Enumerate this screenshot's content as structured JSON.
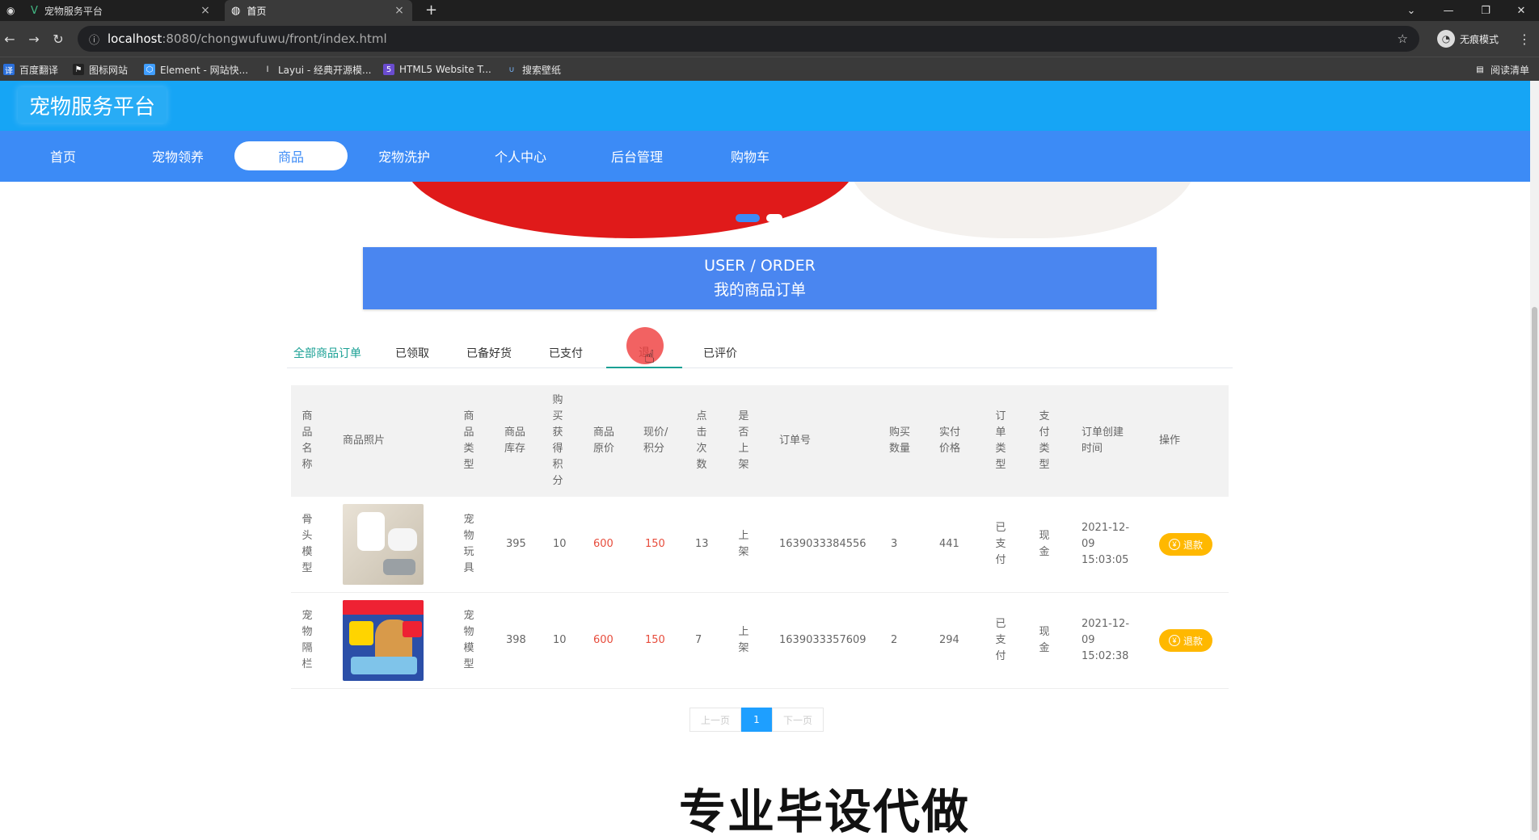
{
  "browser": {
    "tabs": [
      {
        "title": "宠物服务平台",
        "close": "×"
      },
      {
        "title": "首页",
        "close": "×"
      }
    ],
    "new_tab": "+",
    "url_host": "localhost",
    "url_path": ":8080/chongwufuwu/front/index.html",
    "incognito_label": "无痕模式",
    "bookmarks": [
      "百度翻译",
      "图标网站",
      "Element - 网站快...",
      "Layui - 经典开源模...",
      "HTML5 Website T...",
      "搜索壁纸"
    ],
    "reading_list": "阅读清单"
  },
  "site": {
    "title": "宠物服务平台",
    "nav": [
      "首页",
      "宠物领养",
      "商品",
      "宠物洗护",
      "个人中心",
      "后台管理",
      "购物车"
    ],
    "active_nav": "商品"
  },
  "order_header": {
    "en": "USER / ORDER",
    "zh": "我的商品订单"
  },
  "order_tabs": [
    "全部商品订单",
    "已领取",
    "已备好货",
    "已支付",
    "退款",
    "已评价"
  ],
  "order_tab_visible": [
    "全部商品订单",
    "已领取",
    "已备好货",
    "已支付",
    "退",
    "已评价"
  ],
  "table": {
    "headers": [
      "商品名称",
      "商品照片",
      "商品类型",
      "商品库存",
      "购买获得积分",
      "商品原价",
      "现价/积分",
      "点击次数",
      "是否上架",
      "订单号",
      "购买数量",
      "实付价格",
      "订单类型",
      "支付类型",
      "订单创建时间",
      "操作"
    ],
    "rows": [
      {
        "name": "骨头模型",
        "type": "宠物玩具",
        "stock": "395",
        "points": "10",
        "orig_price": "600",
        "cur_price": "150",
        "clicks": "13",
        "on_shelf": "上架",
        "order_no": "1639033384556",
        "qty": "3",
        "paid": "441",
        "order_type": "已支付",
        "pay_type": "现金",
        "created": "2021-12-09 15:03:05",
        "action": "退款"
      },
      {
        "name": "宠物隔栏",
        "type": "宠物模型",
        "stock": "398",
        "points": "10",
        "orig_price": "600",
        "cur_price": "150",
        "clicks": "7",
        "on_shelf": "上架",
        "order_no": "1639033357609",
        "qty": "2",
        "paid": "294",
        "order_type": "已支付",
        "pay_type": "现金",
        "created": "2021-12-09 15:02:38",
        "action": "退款"
      }
    ]
  },
  "pager": {
    "prev": "上一页",
    "current": "1",
    "next": "下一页"
  },
  "watermark": "专业毕设代做",
  "colors": {
    "header": "#16a5f5",
    "nav": "#3c8bf6",
    "accent": "#1aa094",
    "refund": "#ffb800",
    "price": "#e74c3c"
  }
}
